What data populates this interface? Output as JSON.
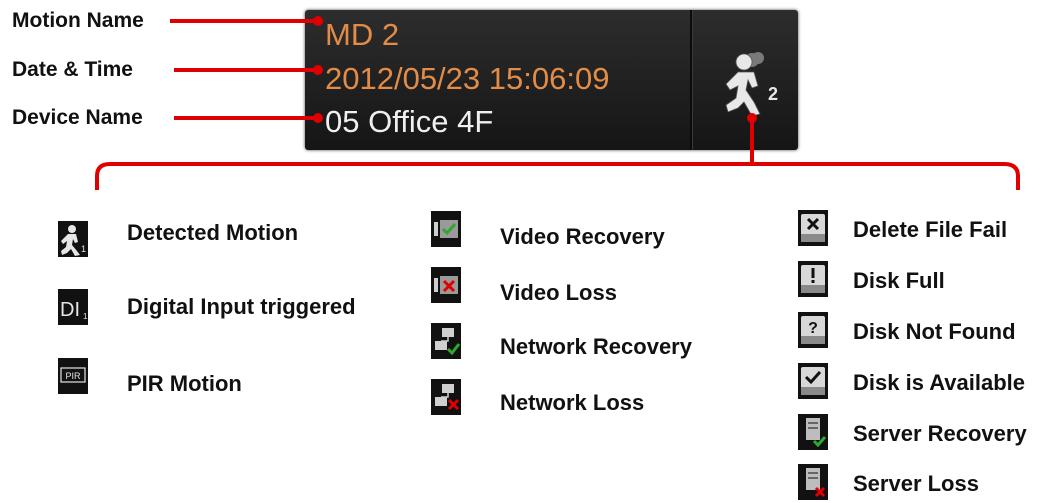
{
  "callouts": {
    "motion_name": "Motion Name",
    "date_time": "Date & Time",
    "device_name": "Device Name"
  },
  "panel": {
    "motion_name": "MD 2",
    "date_time": "2012/05/23 15:06:09",
    "device_name": "05 Office 4F",
    "icon": "running-person-icon",
    "icon_count": "2",
    "accent_color": "#e28c47",
    "callout_color": "#e00000"
  },
  "legend": {
    "col1": [
      {
        "label": "Detected Motion",
        "icon": "motion-icon",
        "icon_text": "1"
      },
      {
        "label": "Digital Input triggered",
        "icon": "digital-input-icon",
        "icon_text": "DI",
        "icon_sub": "1"
      },
      {
        "label": "PIR Motion",
        "icon": "pir-icon",
        "icon_text": "PIR"
      }
    ],
    "col2": [
      {
        "label": "Video Recovery",
        "icon": "video-recovery-icon"
      },
      {
        "label": "Video Loss",
        "icon": "video-loss-icon"
      },
      {
        "label": "Network Recovery",
        "icon": "network-recovery-icon"
      },
      {
        "label": "Network Loss",
        "icon": "network-loss-icon"
      }
    ],
    "col3": [
      {
        "label": "Delete File Fail",
        "icon": "delete-file-fail-icon"
      },
      {
        "label": "Disk Full",
        "icon": "disk-full-icon"
      },
      {
        "label": "Disk Not Found",
        "icon": "disk-not-found-icon"
      },
      {
        "label": "Disk is Available",
        "icon": "disk-available-icon"
      },
      {
        "label": "Server Recovery",
        "icon": "server-recovery-icon"
      },
      {
        "label": "Server Loss",
        "icon": "server-loss-icon"
      }
    ]
  }
}
